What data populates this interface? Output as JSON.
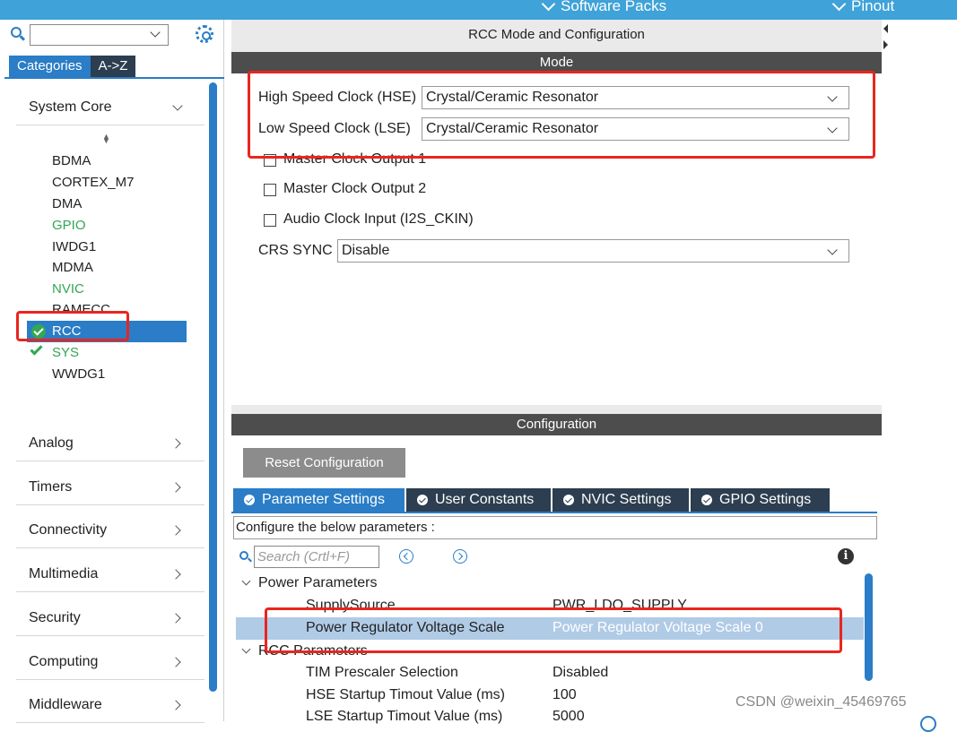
{
  "topbar": {
    "menus": [
      {
        "label": "Software Packs"
      },
      {
        "label": "Pinout"
      }
    ]
  },
  "sidebar": {
    "search_value": "",
    "tabs": [
      {
        "label": "Categories",
        "active": true
      },
      {
        "label": "A->Z",
        "active": false
      }
    ],
    "system_core": {
      "label": "System Core",
      "items": [
        {
          "label": "BDMA",
          "status": "none"
        },
        {
          "label": "CORTEX_M7",
          "status": "none"
        },
        {
          "label": "DMA",
          "status": "none"
        },
        {
          "label": "GPIO",
          "status": "configured"
        },
        {
          "label": "IWDG1",
          "status": "none"
        },
        {
          "label": "MDMA",
          "status": "none"
        },
        {
          "label": "NVIC",
          "status": "configured"
        },
        {
          "label": "RAMECC",
          "status": "none"
        },
        {
          "label": "RCC",
          "status": "selected-ok"
        },
        {
          "label": "SYS",
          "status": "ok"
        },
        {
          "label": "WWDG1",
          "status": "none"
        }
      ]
    },
    "categories": [
      {
        "label": "Analog"
      },
      {
        "label": "Timers"
      },
      {
        "label": "Connectivity"
      },
      {
        "label": "Multimedia"
      },
      {
        "label": "Security"
      },
      {
        "label": "Computing"
      },
      {
        "label": "Middleware"
      }
    ]
  },
  "main": {
    "title": "RCC Mode and Configuration",
    "mode": {
      "header": "Mode",
      "hse": {
        "label": "High Speed Clock (HSE)",
        "value": "Crystal/Ceramic Resonator"
      },
      "lse": {
        "label": "Low Speed Clock (LSE)",
        "value": "Crystal/Ceramic Resonator"
      },
      "checkboxes": [
        {
          "label": "Master Clock Output 1",
          "checked": false
        },
        {
          "label": "Master Clock Output 2",
          "checked": false
        },
        {
          "label": "Audio Clock Input (I2S_CKIN)",
          "checked": false
        }
      ],
      "crs_sync": {
        "label": "CRS SYNC",
        "value": "Disable"
      }
    },
    "configuration": {
      "header": "Configuration",
      "reset_label": "Reset Configuration",
      "tabs": [
        {
          "label": "Parameter Settings",
          "active": true
        },
        {
          "label": "User Constants",
          "active": false
        },
        {
          "label": "NVIC Settings",
          "active": false
        },
        {
          "label": "GPIO Settings",
          "active": false
        }
      ],
      "configure_text": "Configure the below parameters :",
      "search_placeholder": "Search (Crtl+F)",
      "groups": [
        {
          "label": "Power Parameters",
          "params": [
            {
              "name": "SupplySource",
              "value": "PWR_LDO_SUPPLY"
            },
            {
              "name": "Power Regulator Voltage Scale",
              "value": "Power Regulator Voltage Scale 0",
              "selected": true
            }
          ]
        },
        {
          "label": "RCC Parameters",
          "params": [
            {
              "name": "TIM Prescaler Selection",
              "value": "Disabled"
            },
            {
              "name": "HSE Startup Timout Value (ms)",
              "value": "100"
            },
            {
              "name": "LSE Startup Timout Value (ms)",
              "value": "5000"
            }
          ]
        }
      ]
    }
  },
  "watermark": "CSDN @weixin_45469765",
  "colors": {
    "topbar": "#3fa2d8",
    "accent": "#2a7dc6",
    "section_bar": "#4d4d4d",
    "tab_dark": "#2c3e50",
    "configured_green": "#32a852",
    "annotation_red": "#e8261e",
    "selected_row": "#b0cbe6"
  }
}
